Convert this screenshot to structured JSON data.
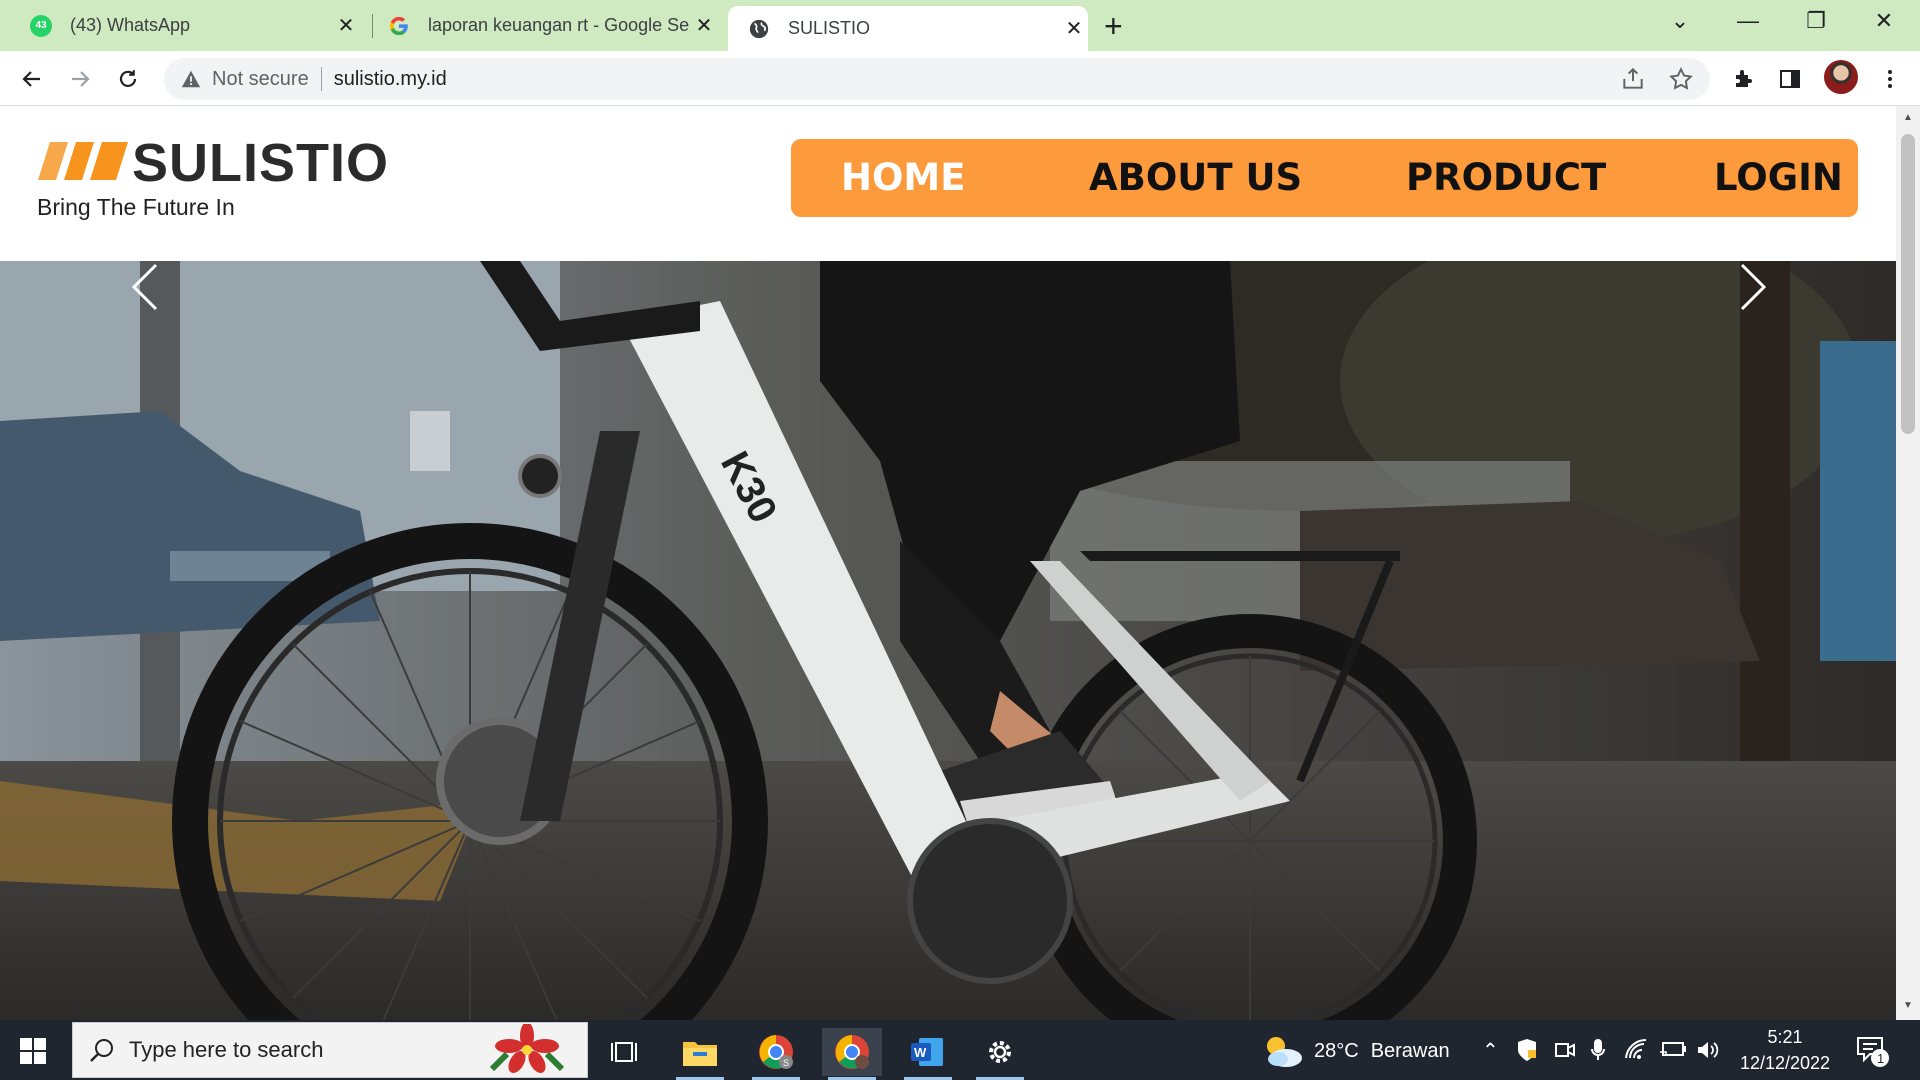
{
  "browser": {
    "tabs": [
      {
        "title": "(43) WhatsApp",
        "badge": "43"
      },
      {
        "title": "laporan keuangan rt - Google Se"
      },
      {
        "title": "SULISTIO"
      }
    ],
    "new_tab": "+",
    "address": {
      "security": "Not secure",
      "url": "sulistio.my.id"
    }
  },
  "site": {
    "brand": "SULISTIO",
    "tagline": "Bring The Future In",
    "nav": [
      "HOME",
      "ABOUT US",
      "PRODUCT",
      "LOGIN"
    ],
    "hero": {
      "bike_brand": "K30"
    },
    "accent_color": "#fd9a3b"
  },
  "taskbar": {
    "search_placeholder": "Type here to search",
    "weather": {
      "temp": "28°C",
      "condition": "Berawan"
    },
    "time": "5:21",
    "date": "12/12/2022",
    "notifications": "1"
  }
}
